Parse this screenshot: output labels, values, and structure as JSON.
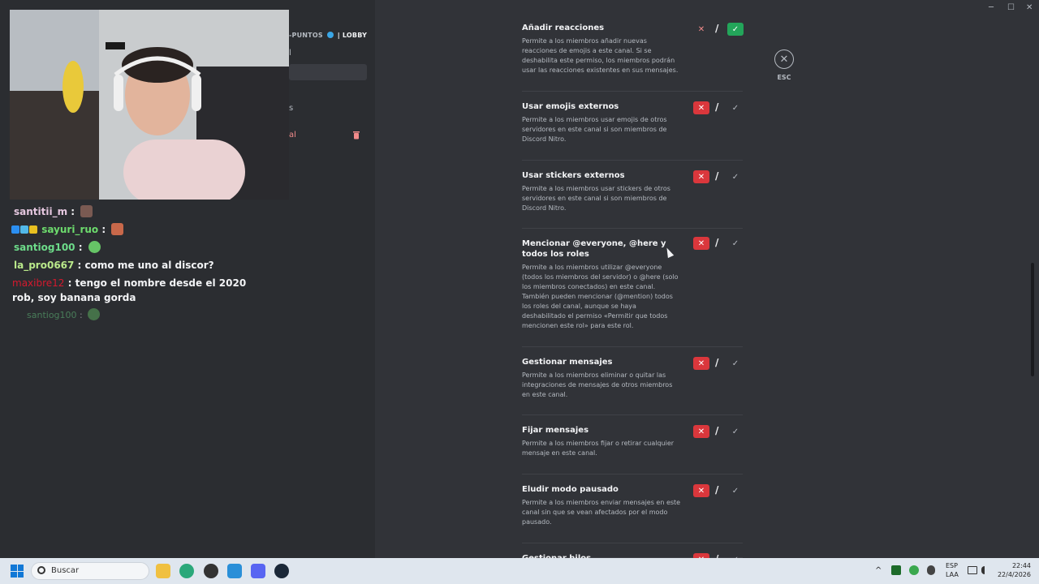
{
  "window": {
    "minimize": "─",
    "maximize": "☐",
    "close": "✕"
  },
  "sidebar": {
    "header": "-PUNTOS",
    "header_suffix": "| LOBBY",
    "frag1": "l",
    "frag2": "s",
    "frag3": "al"
  },
  "chat": {
    "lines": [
      {
        "user": "santitii_m",
        "sep": " :",
        "msg": "",
        "color": "#e0b0d0"
      },
      {
        "user": "sayuri_ruo",
        "sep": " :",
        "msg": "",
        "color": "#6ddc6d"
      },
      {
        "user": "santiog100",
        "sep": " :",
        "msg": "",
        "color": "#6ddc8a"
      },
      {
        "user": "la_pro0667",
        "sep": " :",
        "msg": " como me uno al discor?",
        "color": "#b9e88a"
      },
      {
        "user": "maxibre12",
        "sep": " :",
        "msg": " tengo el nombre desde el 2020 rob, soy banana gorda",
        "color": "#d6192e"
      }
    ],
    "faded": {
      "user": "santiog100",
      "sep": " :"
    }
  },
  "permissions": [
    {
      "title": "Añadir reacciones",
      "desc": "Permite a los miembros añadir nuevas reacciones de emojis a este canal. Si se deshabilita este permiso, los miembros podrán usar las reacciones existentes en sus mensajes.",
      "state": "allow"
    },
    {
      "title": "Usar emojis externos",
      "desc": "Permite a los miembros usar emojis de otros servidores en este canal si son miembros de Discord Nitro.",
      "state": "deny"
    },
    {
      "title": "Usar stickers externos",
      "desc": "Permite a los miembros usar stickers de otros servidores en este canal si son miembros de Discord Nitro.",
      "state": "deny"
    },
    {
      "title": "Mencionar @everyone, @here y todos los roles",
      "desc": "Permite a los miembros utilizar @everyone (todos los miembros del servidor) o @here (solo los miembros conectados) en este canal. También pueden mencionar (@mention) todos los roles del canal, aunque se haya deshabilitado el permiso «Permitir que todos mencionen este rol» para este rol.",
      "state": "deny"
    },
    {
      "title": "Gestionar mensajes",
      "desc": "Permite a los miembros eliminar o quitar las integraciones de mensajes de otros miembros en este canal.",
      "state": "deny"
    },
    {
      "title": "Fijar mensajes",
      "desc": "Permite a los miembros fijar o retirar cualquier mensaje en este canal.",
      "state": "deny"
    },
    {
      "title": "Eludir modo pausado",
      "desc": "Permite a los miembros enviar mensajes en este canal sin que se vean afectados por el modo pausado.",
      "state": "deny"
    },
    {
      "title": "Gestionar hilos",
      "desc": "",
      "state": "deny"
    }
  ],
  "toggle_glyphs": {
    "deny": "✕",
    "slash": "/",
    "allow": "✓"
  },
  "esc": {
    "icon": "✕",
    "label": "ESC"
  },
  "taskbar": {
    "search_placeholder": "Buscar",
    "lang": "ESP",
    "lang2": "LAA",
    "time": "22:44",
    "date": "22/4/2026",
    "chevron": "^"
  },
  "colors": {
    "deny": "#da373c",
    "allow": "#23a55a",
    "bg": "#313338"
  }
}
